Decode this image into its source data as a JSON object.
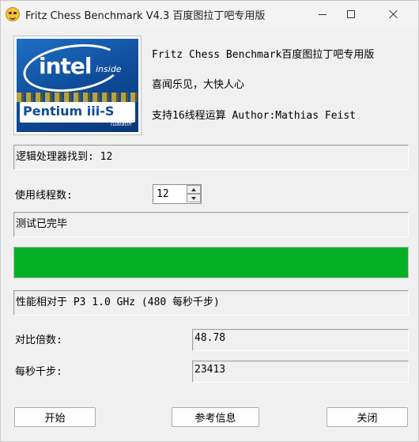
{
  "window": {
    "title": "Fritz Chess Benchmark V4.3   百度图拉丁吧专用版"
  },
  "logo": {
    "brand": "intel",
    "inside": "inside",
    "product": "Pentium iii-S",
    "sub": "Tualatin"
  },
  "info": {
    "line1": "Fritz Chess Benchmark百度图拉丁吧专用版",
    "line2": "喜闻乐见，大快人心",
    "line3": "支持16线程运算   Author:Mathias Feist"
  },
  "processors_found": "逻辑处理器找到: 12",
  "threads": {
    "label": "使用线程数:",
    "value": "12"
  },
  "status": "测试已完毕",
  "progress": {
    "fraction": 1.0,
    "color": "#06b025"
  },
  "relative": "性能相对于 P3 1.0 GHz (480 每秒千步)",
  "ratio": {
    "label": "对比倍数:",
    "value": "48.78"
  },
  "knps": {
    "label": "每秒千步:",
    "value": "23413"
  },
  "buttons": {
    "start": "开始",
    "info": "参考信息",
    "close": "关闭"
  }
}
